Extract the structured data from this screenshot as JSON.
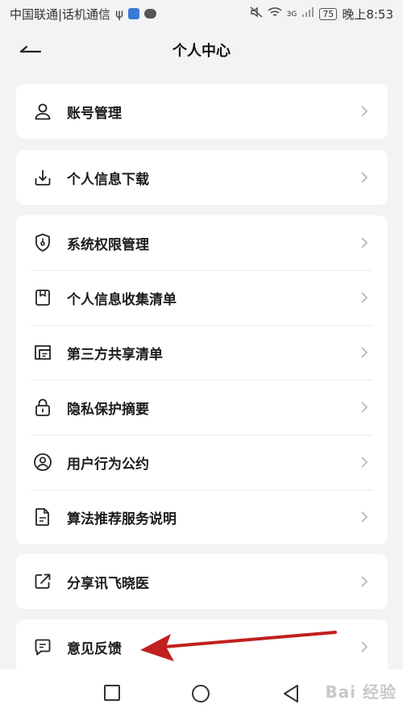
{
  "status_bar": {
    "carrier": "中国联通|话机通信",
    "battery": "75",
    "time": "晚上8:53",
    "network": "3G"
  },
  "header": {
    "title": "个人中心"
  },
  "menu": [
    {
      "label": "账号管理",
      "icon": "user-icon"
    },
    {
      "label": "个人信息下载",
      "icon": "download-icon"
    },
    {
      "label": "系统权限管理",
      "icon": "shield-icon"
    },
    {
      "label": "个人信息收集清单",
      "icon": "bookmark-doc-icon"
    },
    {
      "label": "第三方共享清单",
      "icon": "share-list-icon"
    },
    {
      "label": "隐私保护摘要",
      "icon": "lock-icon"
    },
    {
      "label": "用户行为公约",
      "icon": "user-circle-icon"
    },
    {
      "label": "算法推荐服务说明",
      "icon": "document-icon"
    },
    {
      "label": "分享讯飞晓医",
      "icon": "share-icon"
    },
    {
      "label": "意见反馈",
      "icon": "feedback-icon"
    }
  ],
  "watermark": "Bai 经验",
  "colors": {
    "annotation_arrow": "#c0201e",
    "card_bg": "#ffffff",
    "page_bg": "#f3f3f5"
  }
}
